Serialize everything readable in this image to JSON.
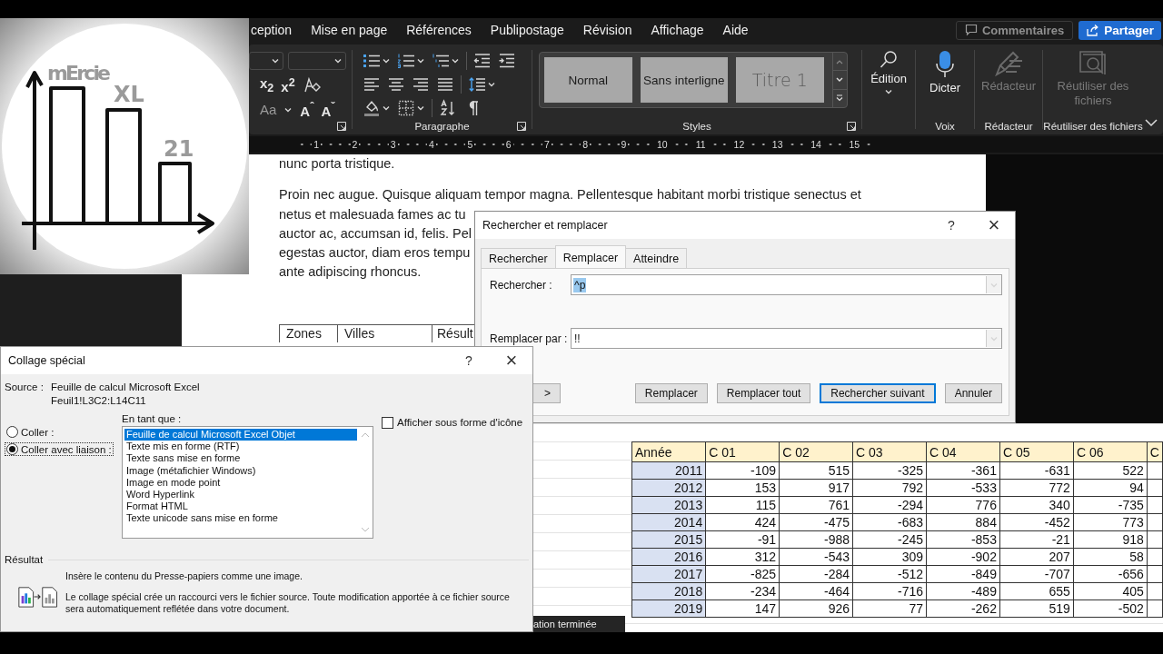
{
  "logo": {
    "texts": [
      "mErcie",
      "XL",
      "21"
    ]
  },
  "word": {
    "tabs": [
      "ception",
      "Mise en page",
      "Références",
      "Publipostage",
      "Révision",
      "Affichage",
      "Aide"
    ],
    "comments_button": "Commentaires",
    "share_button": "Partager",
    "ribbon": {
      "font_tools": [
        {
          "kind": "text",
          "label": "x$_{2}$"
        },
        {
          "kind": "text",
          "label": "x$^{2}$"
        },
        {
          "kind": "eraser"
        },
        {
          "kind": "case",
          "label": "Aa"
        },
        {
          "kind": "text",
          "label": "A$^{ˆ}$"
        },
        {
          "kind": "text",
          "label": "A$^{ˇ}$"
        }
      ],
      "paragraph_label": "Paragraphe",
      "styles": [
        {
          "label": "Normal",
          "kind": "body"
        },
        {
          "label": "Sans interligne",
          "kind": "body"
        },
        {
          "label": "Titre 1",
          "kind": "heading"
        }
      ],
      "styles_label": "Styles",
      "commands": [
        {
          "kind": "search",
          "label": "Édition",
          "disabled": false
        },
        {
          "kind": "mic",
          "label": "Dicter",
          "group": "Voix",
          "disabled": false
        },
        {
          "kind": "pen",
          "label": "Rédacteur",
          "group": "Rédacteur",
          "disabled": true
        },
        {
          "kind": "reuse",
          "label": "Réutiliser des fichiers",
          "group": "Réutiliser des fichiers",
          "disabled": true
        }
      ]
    },
    "ruler": [
      "1",
      "2",
      "3",
      "4",
      "5",
      "6",
      "7",
      "8",
      "9",
      "10",
      "11",
      "12",
      "13",
      "14",
      "15"
    ],
    "document": {
      "lines": [
        "nunc porta tristique."
      ],
      "paragraph": [
        "Proin nec augue. Quisque aliquam tempor magna. Pellentesque habitant morbi tristique senectus et",
        "netus et malesuada fames ac tu",
        "auctor ac, accumsan id, felis. Pel",
        "egestas auctor, diam eros tempu",
        "ante adipiscing rhoncus."
      ],
      "table_header": [
        "Zones",
        "Villes",
        "Résult"
      ]
    }
  },
  "find_dialog": {
    "title": "Rechercher et remplacer",
    "help": "?",
    "close": "×",
    "tabs": [
      {
        "label": "Rechercher",
        "selected": false
      },
      {
        "label": "Remplacer",
        "selected": true
      },
      {
        "label": "Atteindre",
        "selected": false
      }
    ],
    "fields": [
      {
        "label": "Rechercher :",
        "value": "^p",
        "highlighted": true
      },
      {
        "label": "Remplacer par :",
        "value": "!!",
        "highlighted": false
      }
    ],
    "more_button": ">",
    "buttons": [
      {
        "label": "Remplacer",
        "default": false
      },
      {
        "label": "Remplacer tout",
        "default": false
      },
      {
        "label": "Rechercher suivant",
        "default": true
      },
      {
        "label": "Annuler",
        "default": false
      }
    ]
  },
  "paste_dialog": {
    "title": "Collage spécial",
    "help": "?",
    "close": "×",
    "source_label": "Source :",
    "source": [
      "Feuille de calcul Microsoft Excel",
      "Feuil1!L3C2:L14C11"
    ],
    "as_label": "En tant que :",
    "options": [
      {
        "label": "Coller :",
        "selected": false
      },
      {
        "label": "Coller avec liaison :",
        "selected": true
      }
    ],
    "formats": [
      {
        "label": "Feuille de calcul Microsoft Excel Objet",
        "selected": true
      },
      {
        "label": "Texte mis en forme (RTF)",
        "selected": false
      },
      {
        "label": "Texte sans mise en forme",
        "selected": false
      },
      {
        "label": "Image (métafichier Windows)",
        "selected": false
      },
      {
        "label": "Image en mode point",
        "selected": false
      },
      {
        "label": "Word Hyperlink",
        "selected": false
      },
      {
        "label": "Format HTML",
        "selected": false
      },
      {
        "label": "Texte unicode sans mise en forme",
        "selected": false
      }
    ],
    "icon_checkbox": {
      "label": "Afficher sous forme d'icône",
      "checked": false
    },
    "result_label": "Résultat",
    "result_texts": [
      "Insère le contenu du Presse-papiers comme une image.",
      "Le collage spécial crée un raccourci vers le fichier source. Toute modification apportée à ce fichier source sera automatiquement reflétée dans votre document."
    ]
  },
  "spreadsheet": {
    "columns": [
      "Année",
      "C 01",
      "C 02",
      "C 03",
      "C 04",
      "C 05",
      "C 06",
      "C"
    ],
    "rows": [
      {
        "year": "2011",
        "values": [
          "-109",
          "515",
          "-325",
          "-361",
          "-631",
          "522"
        ]
      },
      {
        "year": "2012",
        "values": [
          "153",
          "917",
          "792",
          "-533",
          "772",
          "94"
        ]
      },
      {
        "year": "2013",
        "values": [
          "115",
          "761",
          "-294",
          "776",
          "340",
          "-735"
        ]
      },
      {
        "year": "2014",
        "values": [
          "424",
          "-475",
          "-683",
          "884",
          "-452",
          "773"
        ]
      },
      {
        "year": "2015",
        "values": [
          "-91",
          "-988",
          "-245",
          "-853",
          "-21",
          "918"
        ]
      },
      {
        "year": "2016",
        "values": [
          "312",
          "-543",
          "309",
          "-902",
          "207",
          "58"
        ]
      },
      {
        "year": "2017",
        "values": [
          "-825",
          "-284",
          "-512",
          "-849",
          "-707",
          "-656"
        ]
      },
      {
        "year": "2018",
        "values": [
          "-234",
          "-464",
          "-716",
          "-489",
          "655",
          "405"
        ]
      },
      {
        "year": "2019",
        "values": [
          "147",
          "926",
          "77",
          "-262",
          "519",
          "-502"
        ]
      }
    ]
  },
  "status_bar": "ation terminée"
}
